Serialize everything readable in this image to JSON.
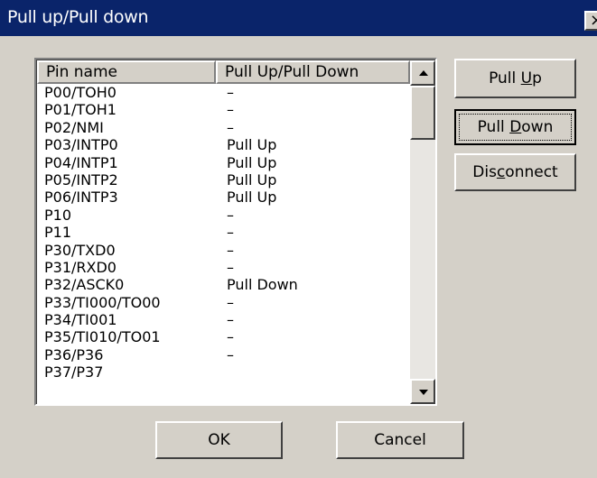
{
  "window": {
    "title": "Pull up/Pull down",
    "close_label": "×"
  },
  "list": {
    "columns": [
      "Pin name",
      "Pull Up/Pull Down"
    ],
    "rows": [
      {
        "pin": "P00/TOH0",
        "pull": "–"
      },
      {
        "pin": "P01/TOH1",
        "pull": "–"
      },
      {
        "pin": "P02/NMI",
        "pull": "–"
      },
      {
        "pin": "P03/INTP0",
        "pull": "Pull Up"
      },
      {
        "pin": "P04/INTP1",
        "pull": "Pull Up"
      },
      {
        "pin": "P05/INTP2",
        "pull": "Pull Up"
      },
      {
        "pin": "P06/INTP3",
        "pull": "Pull Up"
      },
      {
        "pin": "P10",
        "pull": "–"
      },
      {
        "pin": "P11",
        "pull": "–"
      },
      {
        "pin": "P30/TXD0",
        "pull": "–"
      },
      {
        "pin": "P31/RXD0",
        "pull": "–"
      },
      {
        "pin": "P32/ASCK0",
        "pull": "Pull Down"
      },
      {
        "pin": "P33/TI000/TO00",
        "pull": "–"
      },
      {
        "pin": "P34/TI001",
        "pull": "–"
      },
      {
        "pin": "P35/TI010/TO01",
        "pull": "–"
      },
      {
        "pin": "P36/P36",
        "pull": "–"
      },
      {
        "pin": "P37/P37",
        "pull": ""
      }
    ]
  },
  "buttons": {
    "pull_up": {
      "pre": "Pull ",
      "mnemonic": "U",
      "post": "p"
    },
    "pull_down": {
      "pre": "Pull ",
      "mnemonic": "D",
      "post": "own"
    },
    "disconnect": {
      "pre": "Dis",
      "mnemonic": "c",
      "post": "onnect"
    },
    "ok": "OK",
    "cancel": "Cancel"
  },
  "colors": {
    "titlebar": "#0a246a",
    "dialog_face": "#d4d0c8"
  }
}
